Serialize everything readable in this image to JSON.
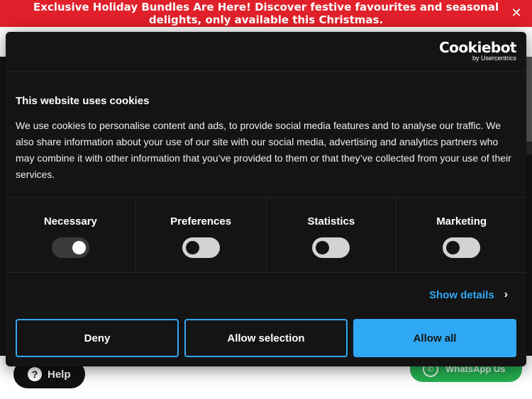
{
  "promo": {
    "text": "Exclusive Holiday Bundles Are Here! Discover festive favourites and seasonal delights, only available this Christmas.",
    "close_icon": "close-icon"
  },
  "dialog": {
    "logo_main": "Cookiebot",
    "logo_sub": "by Usercentrics",
    "heading": "This website uses cookies",
    "body": "We use cookies to personalise content and ads, to provide social media features and to analyse our traffic. We also share information about your use of our site with our social media, advertising and analytics partners who may combine it with other information that you’ve provided to them or that they’ve collected from your use of their services.",
    "categories": [
      {
        "label": "Necessary",
        "state": "on"
      },
      {
        "label": "Preferences",
        "state": "off"
      },
      {
        "label": "Statistics",
        "state": "off"
      },
      {
        "label": "Marketing",
        "state": "off"
      }
    ],
    "show_details": "Show details",
    "buttons": {
      "deny": "Deny",
      "allow_selection": "Allow selection",
      "allow_all": "Allow all"
    }
  },
  "widgets": {
    "help": "Help",
    "whatsapp": "WhatsApp Us"
  },
  "colors": {
    "banner": "#e0202a",
    "dialog_bg": "#141414",
    "accent": "#2fa8f5",
    "whatsapp": "#25b050"
  }
}
